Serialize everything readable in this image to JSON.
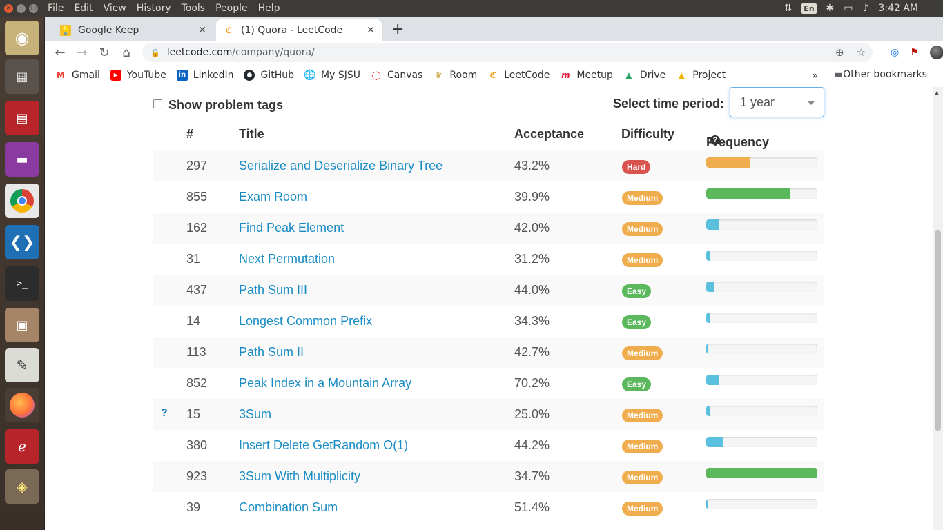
{
  "system_bar": {
    "menus": [
      "File",
      "Edit",
      "View",
      "History",
      "Tools",
      "People",
      "Help"
    ],
    "lang": "En",
    "time": "3:42 AM"
  },
  "tabs": [
    {
      "label": "Google Keep",
      "active": false
    },
    {
      "label": "(1) Quora - LeetCode",
      "active": true
    }
  ],
  "address_bar": {
    "host": "leetcode.com",
    "path": "/company/quora/"
  },
  "bookmarks": [
    {
      "label": "Gmail",
      "icon": "gmail-icon",
      "color": "#ea4335"
    },
    {
      "label": "YouTube",
      "icon": "youtube-icon",
      "color": "#ff0000"
    },
    {
      "label": "LinkedIn",
      "icon": "linkedin-icon",
      "color": "#0a66c2"
    },
    {
      "label": "GitHub",
      "icon": "github-icon",
      "color": "#24292e"
    },
    {
      "label": "My SJSU",
      "icon": "globe-icon",
      "color": "#555555"
    },
    {
      "label": "Canvas",
      "icon": "canvas-icon",
      "color": "#e72429"
    },
    {
      "label": "Room",
      "icon": "room-icon",
      "color": "#c9a13a"
    },
    {
      "label": "LeetCode",
      "icon": "leetcode-icon",
      "color": "#f89f1b"
    },
    {
      "label": "Meetup",
      "icon": "meetup-icon",
      "color": "#e51937"
    },
    {
      "label": "Drive",
      "icon": "drive-icon",
      "color": "#1fa463"
    },
    {
      "label": "Project",
      "icon": "drive-icon",
      "color": "#1fa463"
    }
  ],
  "other_bookmarks": "Other bookmarks",
  "page": {
    "show_tags_label": "Show problem tags",
    "period_label": "Select time period:",
    "period_value": "1 year",
    "columns": {
      "num": "#",
      "title": "Title",
      "acceptance": "Acceptance",
      "difficulty": "Difficulty",
      "frequency": "Frequency"
    },
    "problems": [
      {
        "num": "297",
        "title": "Serialize and Deserialize Binary Tree",
        "acceptance": "43.2%",
        "difficulty": "Hard",
        "frequency": 0.4,
        "freq_color": "#f0ad4e",
        "mark": ""
      },
      {
        "num": "855",
        "title": "Exam Room",
        "acceptance": "39.9%",
        "difficulty": "Medium",
        "frequency": 0.76,
        "freq_color": "#5cb85c",
        "mark": ""
      },
      {
        "num": "162",
        "title": "Find Peak Element",
        "acceptance": "42.0%",
        "difficulty": "Medium",
        "frequency": 0.11,
        "freq_color": "#5bc0de",
        "mark": ""
      },
      {
        "num": "31",
        "title": "Next Permutation",
        "acceptance": "31.2%",
        "difficulty": "Medium",
        "frequency": 0.03,
        "freq_color": "#5bc0de",
        "mark": ""
      },
      {
        "num": "437",
        "title": "Path Sum III",
        "acceptance": "44.0%",
        "difficulty": "Easy",
        "frequency": 0.07,
        "freq_color": "#5bc0de",
        "mark": ""
      },
      {
        "num": "14",
        "title": "Longest Common Prefix",
        "acceptance": "34.3%",
        "difficulty": "Easy",
        "frequency": 0.03,
        "freq_color": "#5bc0de",
        "mark": ""
      },
      {
        "num": "113",
        "title": "Path Sum II",
        "acceptance": "42.7%",
        "difficulty": "Medium",
        "frequency": 0.02,
        "freq_color": "#5bc0de",
        "mark": ""
      },
      {
        "num": "852",
        "title": "Peak Index in a Mountain Array",
        "acceptance": "70.2%",
        "difficulty": "Easy",
        "frequency": 0.11,
        "freq_color": "#5bc0de",
        "mark": ""
      },
      {
        "num": "15",
        "title": "3Sum",
        "acceptance": "25.0%",
        "difficulty": "Medium",
        "frequency": 0.03,
        "freq_color": "#5bc0de",
        "mark": "?"
      },
      {
        "num": "380",
        "title": "Insert Delete GetRandom O(1)",
        "acceptance": "44.2%",
        "difficulty": "Medium",
        "frequency": 0.15,
        "freq_color": "#5bc0de",
        "mark": ""
      },
      {
        "num": "923",
        "title": "3Sum With Multiplicity",
        "acceptance": "34.7%",
        "difficulty": "Medium",
        "frequency": 1.0,
        "freq_color": "#5cb85c",
        "mark": ""
      },
      {
        "num": "39",
        "title": "Combination Sum",
        "acceptance": "51.4%",
        "difficulty": "Medium",
        "frequency": 0.01,
        "freq_color": "#5bc0de",
        "mark": ""
      }
    ]
  }
}
